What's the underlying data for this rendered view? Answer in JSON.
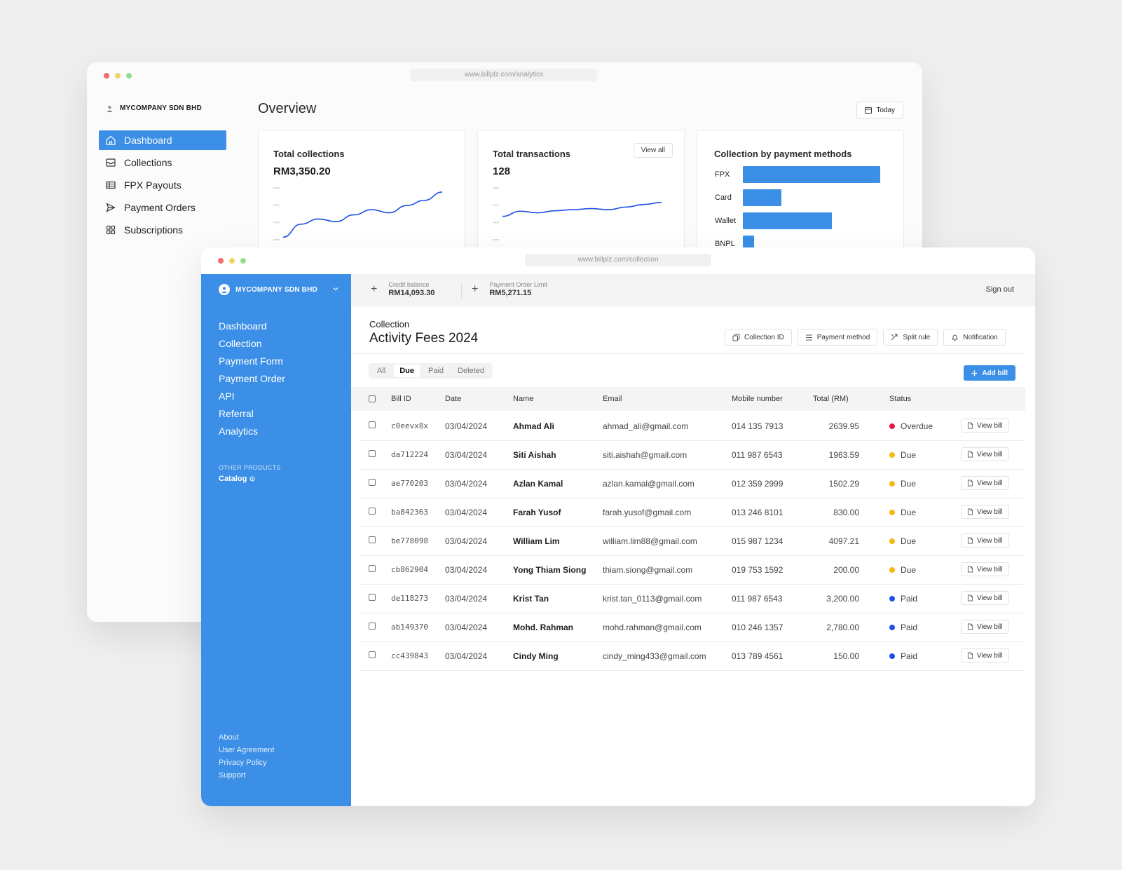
{
  "colors": {
    "accent": "#3b8fe6",
    "overdue": "#e8184a",
    "due": "#f5b90f",
    "paid": "#1f4fe8",
    "dot_red": "#f26b6b",
    "dot_yellow": "#f2d36b",
    "dot_green": "#8fe08f"
  },
  "analytics_window": {
    "url": "www.billplz.com/analytics",
    "company": "MYCOMPANY SDN BHD",
    "title": "Overview",
    "date_button": "Today",
    "nav": [
      {
        "label": "Dashboard",
        "icon": "home-icon",
        "active": true
      },
      {
        "label": "Collections",
        "icon": "inbox-icon",
        "active": false
      },
      {
        "label": "FPX Payouts",
        "icon": "table-icon",
        "active": false
      },
      {
        "label": "Payment Orders",
        "icon": "send-icon",
        "active": false
      },
      {
        "label": "Subscriptions",
        "icon": "grid-icon",
        "active": false
      }
    ],
    "cards": {
      "collections": {
        "title": "Total collections",
        "value": "RM3,350.20"
      },
      "transactions": {
        "title": "Total transactions",
        "value": "128",
        "view_all": "View all"
      },
      "methods": {
        "title": "Collection by payment methods"
      }
    }
  },
  "chart_data": [
    {
      "type": "line",
      "title": "Total collections",
      "x": [
        1,
        2,
        3,
        4,
        5,
        6,
        7,
        8,
        9,
        10
      ],
      "values": [
        5,
        30,
        40,
        35,
        48,
        58,
        52,
        66,
        76,
        92
      ],
      "ylim": [
        0,
        100
      ]
    },
    {
      "type": "line",
      "title": "Total transactions",
      "x": [
        1,
        2,
        3,
        4,
        5,
        6,
        7,
        8,
        9,
        10
      ],
      "values": [
        45,
        55,
        52,
        56,
        58,
        60,
        58,
        63,
        68,
        72
      ],
      "ylim": [
        0,
        100
      ]
    },
    {
      "type": "bar",
      "title": "Collection by payment methods",
      "orientation": "horizontal",
      "categories": [
        "FPX",
        "Card",
        "Wallet",
        "BNPL"
      ],
      "values": [
        100,
        28,
        65,
        8
      ]
    }
  ],
  "collection_window": {
    "url": "www.billplz.com/collection",
    "company": "MYCOMPANY SDN BHD",
    "nav": [
      "Dashboard",
      "Collection",
      "Payment Form",
      "Payment Order",
      "API",
      "Referral",
      "Analytics"
    ],
    "other_products_label": "OTHER PRODUCTS",
    "catalog": "Catalog",
    "footer": [
      "About",
      "User Agreement",
      "Privacy Policy",
      "Support"
    ],
    "credit": {
      "label": "Credit balance",
      "value": "RM14,093.30"
    },
    "po_limit": {
      "label": "Payment Order Limit",
      "value": "RM5,271.15"
    },
    "signout": "Sign out",
    "breadcrumb": "Collection",
    "title": "Activity Fees 2024",
    "actions": [
      {
        "label": "Collection ID",
        "icon": "copy-icon"
      },
      {
        "label": "Payment method",
        "icon": "list-icon"
      },
      {
        "label": "Split rule",
        "icon": "split-icon"
      },
      {
        "label": "Notification",
        "icon": "bell-icon"
      }
    ],
    "tabs": [
      {
        "label": "All",
        "active": false
      },
      {
        "label": "Due",
        "active": true
      },
      {
        "label": "Paid",
        "active": false
      },
      {
        "label": "Deleted",
        "active": false
      }
    ],
    "add_bill": "Add bill",
    "columns": [
      "Bill ID",
      "Date",
      "Name",
      "Email",
      "Mobile number",
      "Total (RM)",
      "Status"
    ],
    "view_bill": "View bill",
    "rows": [
      {
        "id": "c0eevx8x",
        "date": "03/04/2024",
        "name": "Ahmad Ali",
        "email": "ahmad_ali@gmail.com",
        "mobile": "014 135 7913",
        "total": "2639.95",
        "status": "Overdue",
        "status_color": "#e8184a"
      },
      {
        "id": "da712224",
        "date": "03/04/2024",
        "name": "Siti Aishah",
        "email": "siti.aishah@gmail.com",
        "mobile": "011 987 6543",
        "total": "1963.59",
        "status": "Due",
        "status_color": "#f5b90f"
      },
      {
        "id": "ae770203",
        "date": "03/04/2024",
        "name": "Azlan Kamal",
        "email": "azlan.kamal@gmail.com",
        "mobile": "012 359 2999",
        "total": "1502.29",
        "status": "Due",
        "status_color": "#f5b90f"
      },
      {
        "id": "ba842363",
        "date": "03/04/2024",
        "name": "Farah Yusof",
        "email": "farah.yusof@gmail.com",
        "mobile": "013 246 8101",
        "total": "830.00",
        "status": "Due",
        "status_color": "#f5b90f"
      },
      {
        "id": "be778098",
        "date": "03/04/2024",
        "name": "William Lim",
        "email": "william.lim88@gmail.com",
        "mobile": "015 987 1234",
        "total": "4097.21",
        "status": "Due",
        "status_color": "#f5b90f"
      },
      {
        "id": "cb862904",
        "date": "03/04/2024",
        "name": "Yong Thiam Siong",
        "email": "thiam.siong@gmail.com",
        "mobile": "019 753 1592",
        "total": "200.00",
        "status": "Due",
        "status_color": "#f5b90f"
      },
      {
        "id": "de118273",
        "date": "03/04/2024",
        "name": "Krist Tan",
        "email": "krist.tan_0113@gmail.com",
        "mobile": "011 987 6543",
        "total": "3,200.00",
        "status": "Paid",
        "status_color": "#1f4fe8"
      },
      {
        "id": "ab149370",
        "date": "03/04/2024",
        "name": "Mohd. Rahman",
        "email": "mohd.rahman@gmail.com",
        "mobile": "010 246 1357",
        "total": "2,780.00",
        "status": "Paid",
        "status_color": "#1f4fe8"
      },
      {
        "id": "cc439843",
        "date": "03/04/2024",
        "name": "Cindy Ming",
        "email": "cindy_ming433@gmail.com",
        "mobile": "013 789 4561",
        "total": "150.00",
        "status": "Paid",
        "status_color": "#1f4fe8"
      }
    ]
  }
}
